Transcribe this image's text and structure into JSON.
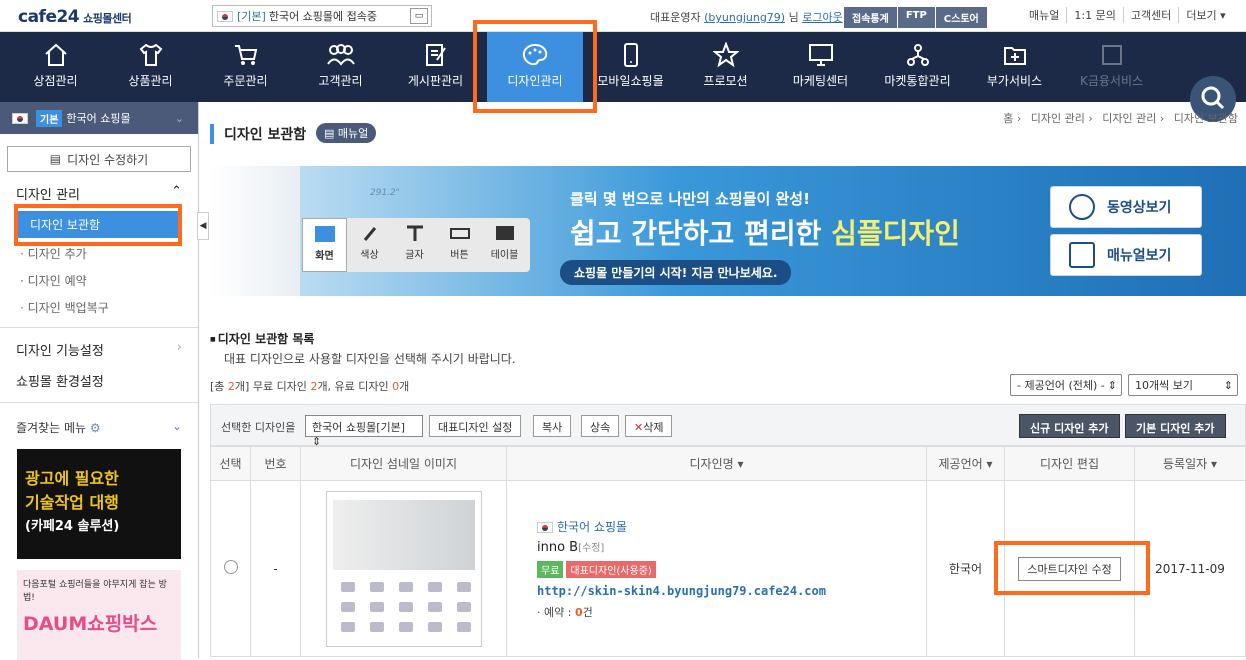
{
  "top": {
    "logo": "cafe24",
    "logo_sub": "쇼핑몰센터",
    "shop_tag": "[기본]",
    "shop_label": "한국어 쇼핑몰에 접속중",
    "owner_prefix": "대표운영자",
    "owner_id": "(byungjung79)",
    "owner_suffix": "님",
    "logout": "로그아웃",
    "buttons": [
      "접속통계",
      "FTP",
      "C스토어"
    ],
    "links": [
      "매뉴얼",
      "1:1 문의",
      "고객센터",
      "더보기 ▾"
    ]
  },
  "nav": {
    "items": [
      {
        "label": "상점관리",
        "icon": "home-icon"
      },
      {
        "label": "상품관리",
        "icon": "tshirt-icon"
      },
      {
        "label": "주문관리",
        "icon": "cart-icon"
      },
      {
        "label": "고객관리",
        "icon": "users-icon"
      },
      {
        "label": "게시판관리",
        "icon": "board-icon"
      },
      {
        "label": "디자인관리",
        "icon": "palette-icon"
      },
      {
        "label": "모바일쇼핑몰",
        "icon": "mobile-icon"
      },
      {
        "label": "프로모션",
        "icon": "star-icon"
      },
      {
        "label": "마케팅센터",
        "icon": "monitor-icon"
      },
      {
        "label": "마켓통합관리",
        "icon": "network-icon"
      },
      {
        "label": "부가서비스",
        "icon": "plus-folder-icon"
      },
      {
        "label": "K금융서비스",
        "icon": "finance-icon"
      }
    ],
    "active_index": 5
  },
  "sidebar": {
    "shop_badge": "기본",
    "shop_name": "한국어 쇼핑몰",
    "edit_button": "디자인 수정하기",
    "group1": "디자인 관리",
    "sub_items": [
      "디자인 보관함",
      "디자인 추가",
      "디자인 예약",
      "디자인 백업복구"
    ],
    "group2": "디자인 기능설정",
    "group3": "쇼핑몰 환경설정",
    "fav": "즐겨찾는 메뉴",
    "ad1_line1": "광고에 필요한",
    "ad1_line2": "기술작업 대행",
    "ad1_line3": "(카페24 솔루션)",
    "ad2_line1": "다음포털 쇼핑러들을 야무지게 잡는 방법!",
    "ad2_line2": "DAUM쇼핑박스"
  },
  "main": {
    "breadcrumb": [
      "홈",
      "디자인 관리",
      "디자인 관리",
      "디자인 보관함"
    ],
    "title": "디자인 보관함",
    "manual": "매뉴얼",
    "banner": {
      "measure": "291.2\"",
      "tools": [
        "화면",
        "색상",
        "글자",
        "버튼",
        "테이블"
      ],
      "line1": "클릭 몇 번으로 나만의 쇼핑몰이 완성!",
      "line2a": "쉽고 간단하고 편리한 ",
      "line2b": "심플디자인",
      "line3": "쇼핑몰 만들기의 시작! 지금 만나보세요.",
      "btn_video": "동영상보기",
      "btn_manual": "매뉴얼보기"
    },
    "list_title": "디자인 보관함 목록",
    "list_desc": "대표 디자인으로 사용할 디자인을 선택해 주시기 바랍니다.",
    "count": {
      "total_pre": "[총 ",
      "total": "2",
      "total_post": "개] 무료 디자인 ",
      "free": "2",
      "mid": "개, 유료 디자인 ",
      "paid": "0",
      "end": "개"
    },
    "lang_filter": "- 제공언어 (전체) -",
    "page_size": "10개씩 보기",
    "action": {
      "label": "선택한 디자인을",
      "shop_select": "한국어 쇼핑몰[기본]",
      "buttons": [
        "대표디자인 설정",
        "복사",
        "상속",
        "삭제"
      ],
      "add_new": "신규 디자인 추가",
      "add_basic": "기본 디자인 추가"
    },
    "columns": [
      "선택",
      "번호",
      "디자인 섬네일 이미지",
      "디자인명 ▾",
      "제공언어 ▾",
      "디자인 편집",
      "등록일자 ▾"
    ],
    "rows": [
      {
        "no": "-",
        "shop": "한국어 쇼핑몰",
        "name": "inno B",
        "edit": "[수정]",
        "badge_free": "무료",
        "badge_main": "대표디자인(사용중)",
        "url": "http://skin-skin4.byungjung79.cafe24.com",
        "reserve_label": "· 예약 : ",
        "reserve_count": "0",
        "reserve_unit": "건",
        "lang": "한국어",
        "edit_button": "스마트디자인 수정",
        "date": "2017-11-09"
      }
    ]
  },
  "colors": {
    "accent": "#3d8fe0",
    "nav_bg": "#1c2a48",
    "highlight": "#ff6a1f"
  }
}
